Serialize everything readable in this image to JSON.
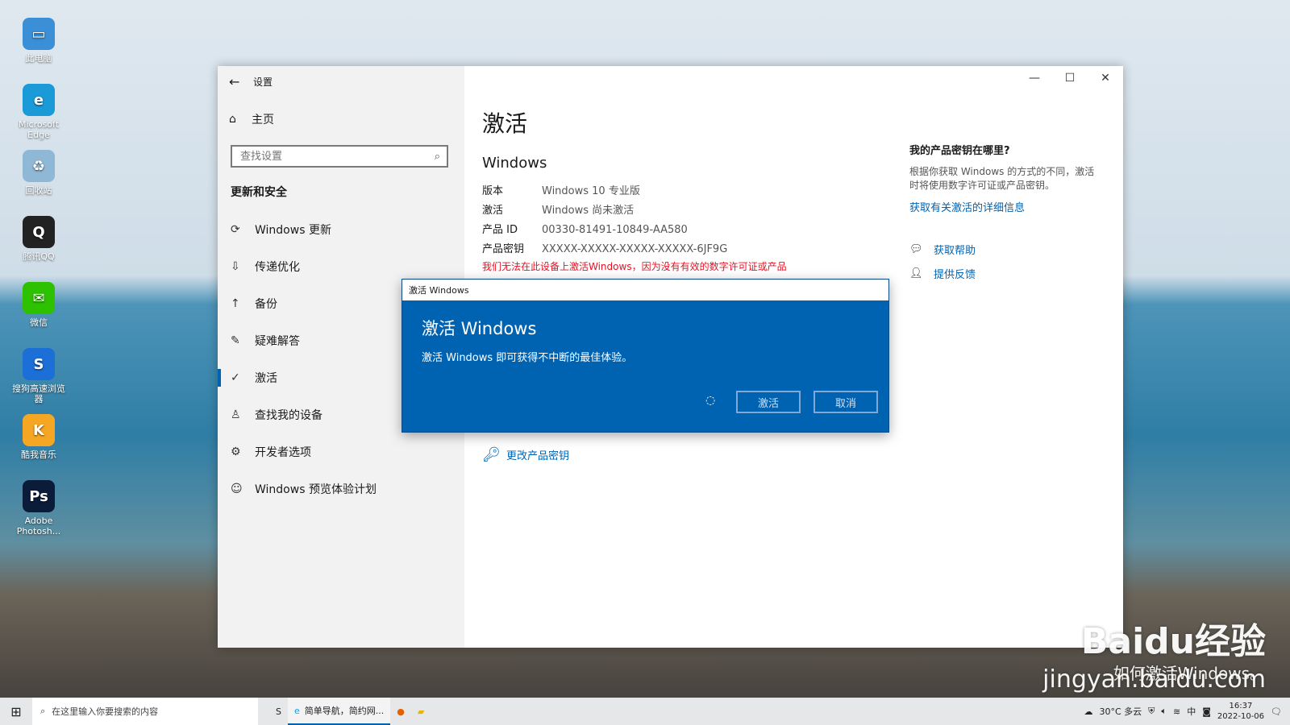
{
  "desktop_icons": [
    {
      "label": "此电脑",
      "icon": "computer-icon",
      "color": "#3a8fd6",
      "glyph": "▭"
    },
    {
      "label": "Microsoft Edge",
      "icon": "edge-icon",
      "color": "#1a9bd7",
      "glyph": "e"
    },
    {
      "label": "回收站",
      "icon": "recycle-bin-icon",
      "color": "#8fb7d6",
      "glyph": "♻"
    },
    {
      "label": "腾讯QQ",
      "icon": "qq-icon",
      "color": "#222222",
      "glyph": "Q"
    },
    {
      "label": "微信",
      "icon": "wechat-icon",
      "color": "#2dc100",
      "glyph": "✉"
    },
    {
      "label": "搜狗高速浏览器",
      "icon": "sogou-browser-icon",
      "color": "#1b6fd6",
      "glyph": "S"
    },
    {
      "label": "酷我音乐",
      "icon": "kuwo-music-icon",
      "color": "#f5a623",
      "glyph": "K"
    },
    {
      "label": "Adobe Photosh...",
      "icon": "photoshop-icon",
      "color": "#0b1b3a",
      "glyph": "Ps"
    }
  ],
  "settings": {
    "title": "设置",
    "home": "主页",
    "search_placeholder": "查找设置",
    "section": "更新和安全",
    "nav_items": [
      {
        "label": "Windows 更新",
        "icon": "refresh-icon",
        "glyph": "⟳"
      },
      {
        "label": "传递优化",
        "icon": "delivery-icon",
        "glyph": "⇩"
      },
      {
        "label": "备份",
        "icon": "backup-icon",
        "glyph": "↑"
      },
      {
        "label": "疑难解答",
        "icon": "wrench-icon",
        "glyph": "✎"
      },
      {
        "label": "激活",
        "icon": "check-circle-icon",
        "glyph": "✓",
        "active": true
      },
      {
        "label": "查找我的设备",
        "icon": "person-pin-icon",
        "glyph": "♙"
      },
      {
        "label": "开发者选项",
        "icon": "developer-icon",
        "glyph": "⚙"
      },
      {
        "label": "Windows 预览体验计划",
        "icon": "insider-icon",
        "glyph": "☺"
      }
    ],
    "page_title": "激活",
    "windows_heading": "Windows",
    "info": [
      {
        "k": "版本",
        "v": "Windows 10 专业版"
      },
      {
        "k": "激活",
        "v": "Windows 尚未激活"
      },
      {
        "k": "产品 ID",
        "v": "00330-81491-10849-AA580"
      },
      {
        "k": "产品密钥",
        "v": "XXXXX-XXXXX-XXXXX-XXXXX-6JF9G"
      }
    ],
    "warning": "我们无法在此设备上激活Windows，因为没有有效的数字许可证或产品",
    "change_key": "更改产品密钥",
    "side_heading": "我的产品密钥在哪里?",
    "side_text": "根据你获取 Windows 的方式的不同，激活时将使用数字许可证或产品密钥。",
    "side_link": "获取有关激活的详细信息",
    "help": "获取帮助",
    "feedback": "提供反馈"
  },
  "dialog": {
    "title": "激活 Windows",
    "heading": "激活 Windows",
    "text": "激活 Windows 即可获得不中断的最佳体验。",
    "activate": "激活",
    "cancel": "取消"
  },
  "watermark": {
    "brand": "Baidu经验",
    "caption": "如何激活Windows。",
    "url": "jingyan.baidu.com"
  },
  "taskbar": {
    "search_placeholder": "在这里输入你要搜索的内容",
    "app_label": "简单导航，简约网...",
    "weather": "30°C 多云",
    "ime": "中",
    "time": "16:37",
    "date": "2022-10-06"
  }
}
